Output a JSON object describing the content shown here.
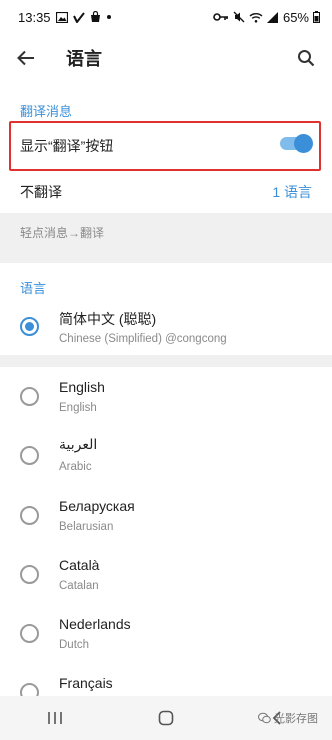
{
  "status_bar": {
    "time": "13:35",
    "battery": "65%",
    "left_icons": [
      "image-icon",
      "check-app-icon",
      "bag-icon",
      "dot-icon"
    ],
    "right_icons": [
      "key-icon",
      "mute-icon",
      "wifi-icon",
      "signal-icon",
      "battery-icon"
    ]
  },
  "app_bar": {
    "title": "语言",
    "back_icon": "arrow-left-icon",
    "search_icon": "search-icon"
  },
  "translate_section": {
    "header": "翻译消息",
    "show_button_label": "显示“翻译”按钮",
    "show_button_enabled": true,
    "no_translate_label": "不翻译",
    "no_translate_value": "1 语言",
    "hint": "轻点消息→翻译"
  },
  "language_section": {
    "header": "语言",
    "selected": {
      "name": "简体中文 (聪聪)",
      "sub": "Chinese (Simplified) @congcong"
    },
    "items": [
      {
        "name": "English",
        "sub": "English"
      },
      {
        "name": "العربية",
        "sub": "Arabic"
      },
      {
        "name": "Беларуская",
        "sub": "Belarusian"
      },
      {
        "name": "Català",
        "sub": "Catalan"
      },
      {
        "name": "Nederlands",
        "sub": "Dutch"
      },
      {
        "name": "Français",
        "sub": ""
      }
    ]
  },
  "nav_bar": {
    "icons": [
      "recent-apps-icon",
      "home-icon",
      "back-icon"
    ]
  },
  "watermark": "光影存图",
  "colors": {
    "accent": "#3a8fd8",
    "highlight_border": "#e03030",
    "band": "#f0f0f0"
  }
}
